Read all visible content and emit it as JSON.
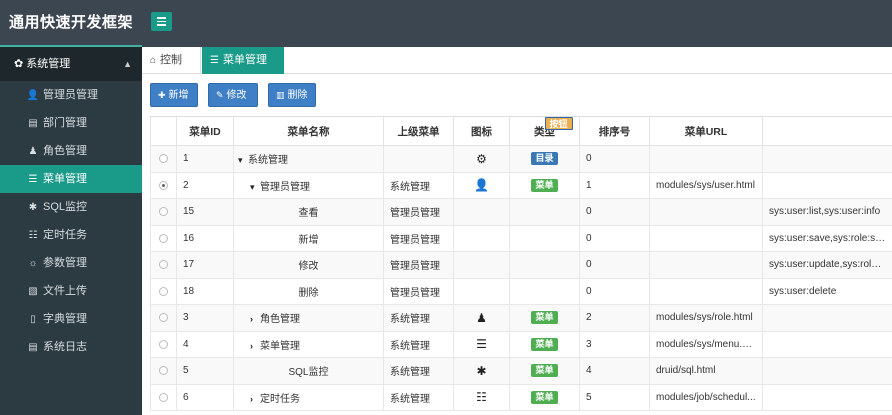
{
  "brand": "通用快速开发框架",
  "sidebar": {
    "group": "系统管理",
    "items": [
      {
        "label": "管理员管理",
        "icon": "user-icon",
        "glyph": "👤"
      },
      {
        "label": "部门管理",
        "icon": "file-icon",
        "glyph": "▤"
      },
      {
        "label": "角色管理",
        "icon": "user-secret-icon",
        "glyph": "♟"
      },
      {
        "label": "菜单管理",
        "icon": "list-icon",
        "glyph": "☰"
      },
      {
        "label": "SQL监控",
        "icon": "bug-icon",
        "glyph": "✱"
      },
      {
        "label": "定时任务",
        "icon": "tasks-icon",
        "glyph": "☷"
      },
      {
        "label": "参数管理",
        "icon": "sun-icon",
        "glyph": "☼"
      },
      {
        "label": "文件上传",
        "icon": "file-image-icon",
        "glyph": "▧"
      },
      {
        "label": "字典管理",
        "icon": "bookmark-icon",
        "glyph": "▯"
      },
      {
        "label": "系统日志",
        "icon": "file-text-icon",
        "glyph": "▤"
      }
    ]
  },
  "tabs": {
    "home": "控制台",
    "current": "菜单管理"
  },
  "toolbar": {
    "add": "新增",
    "edit": "修改",
    "delete": "删除"
  },
  "table": {
    "headers": [
      "菜单ID",
      "菜单名称",
      "上级菜单",
      "图标",
      "类型",
      "排序号",
      "菜单URL"
    ],
    "rows": [
      {
        "id": "1",
        "name": "系统管理",
        "parent": "",
        "icon": "gear-icon",
        "type": "目录",
        "type_kind": "dir",
        "order": "0",
        "url": "",
        "perms": "",
        "checked": false,
        "level": 0,
        "arrow": "▾"
      },
      {
        "id": "2",
        "name": "管理员管理",
        "parent": "系统管理",
        "icon": "user-icon",
        "type": "菜单",
        "type_kind": "menu",
        "order": "1",
        "url": "modules/sys/user.html",
        "perms": "",
        "checked": true,
        "level": 1,
        "arrow": "▾"
      },
      {
        "id": "15",
        "name": "查看",
        "parent": "管理员管理",
        "icon": "",
        "type": "按钮",
        "type_kind": "btn",
        "order": "0",
        "url": "",
        "perms": "sys:user:list,sys:user:info",
        "checked": false,
        "level": 2,
        "arrow": ""
      },
      {
        "id": "16",
        "name": "新增",
        "parent": "管理员管理",
        "icon": "",
        "type": "按钮",
        "type_kind": "btn",
        "order": "0",
        "url": "",
        "perms": "sys:user:save,sys:role:select",
        "checked": false,
        "level": 2,
        "arrow": ""
      },
      {
        "id": "17",
        "name": "修改",
        "parent": "管理员管理",
        "icon": "",
        "type": "按钮",
        "type_kind": "btn",
        "order": "0",
        "url": "",
        "perms": "sys:user:update,sys:role:select",
        "checked": false,
        "level": 2,
        "arrow": ""
      },
      {
        "id": "18",
        "name": "删除",
        "parent": "管理员管理",
        "icon": "",
        "type": "按钮",
        "type_kind": "btn",
        "order": "0",
        "url": "",
        "perms": "sys:user:delete",
        "checked": false,
        "level": 2,
        "arrow": ""
      },
      {
        "id": "3",
        "name": "角色管理",
        "parent": "系统管理",
        "icon": "user-secret-icon",
        "type": "菜单",
        "type_kind": "menu",
        "order": "2",
        "url": "modules/sys/role.html",
        "perms": "",
        "checked": false,
        "level": 1,
        "arrow": "›"
      },
      {
        "id": "4",
        "name": "菜单管理",
        "parent": "系统管理",
        "icon": "list-icon",
        "type": "菜单",
        "type_kind": "menu",
        "order": "3",
        "url": "modules/sys/menu.h...",
        "perms": "",
        "checked": false,
        "level": 1,
        "arrow": "›"
      },
      {
        "id": "5",
        "name": "SQL监控",
        "parent": "系统管理",
        "icon": "bug-icon",
        "type": "菜单",
        "type_kind": "menu",
        "order": "4",
        "url": "druid/sql.html",
        "perms": "",
        "checked": false,
        "level": 2,
        "arrow": ""
      },
      {
        "id": "6",
        "name": "定时任务",
        "parent": "系统管理",
        "icon": "tasks-icon",
        "type": "菜单",
        "type_kind": "menu",
        "order": "5",
        "url": "modules/job/schedul...",
        "perms": "",
        "checked": false,
        "level": 1,
        "arrow": "›"
      }
    ]
  }
}
